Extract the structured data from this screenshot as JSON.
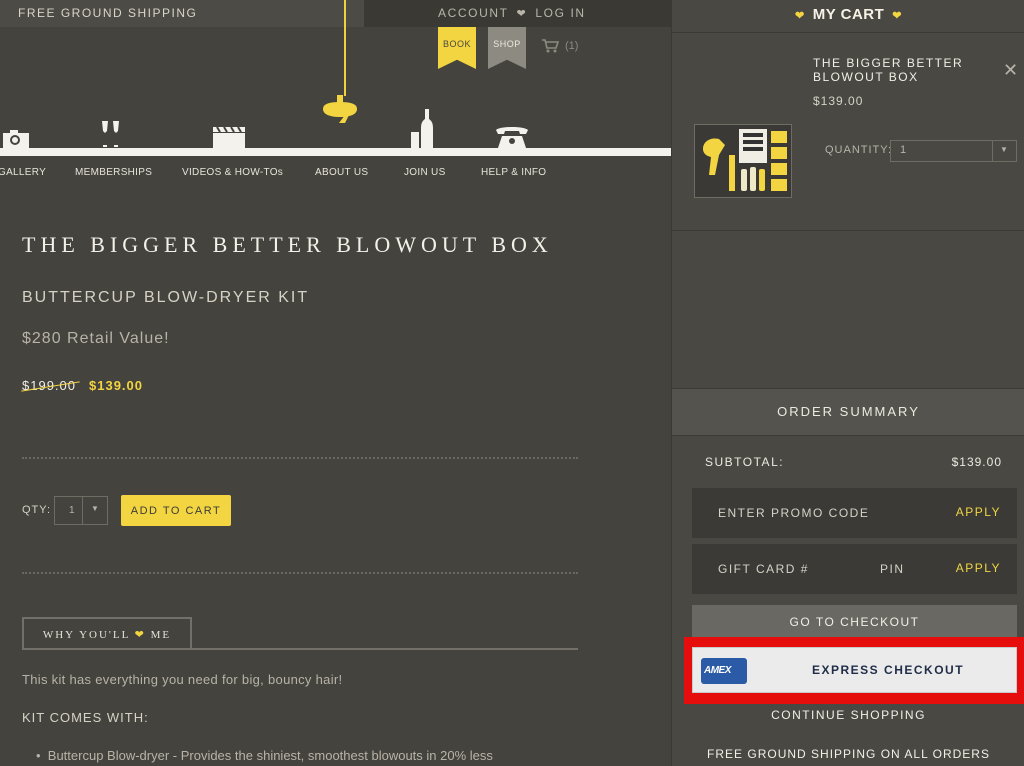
{
  "header": {
    "shipping_text": "FREE GROUND SHIPPING",
    "account_label": "ACCOUNT",
    "login_label": "LOG IN",
    "book_label": "BOOK",
    "shop_label": "SHOP",
    "cart_count": "(1)"
  },
  "nav": {
    "items": [
      "GALLERY",
      "MEMBERSHIPS",
      "VIDEOS & HOW-TOs",
      "ABOUT US",
      "JOIN US",
      "HELP & INFO"
    ]
  },
  "product": {
    "title": "THE BIGGER BETTER BLOWOUT BOX",
    "subtitle": "BUTTERCUP BLOW-DRYER KIT",
    "retail_value": "$280 Retail Value!",
    "old_price": "$199.00",
    "new_price": "$139.00",
    "qty_label": "QTY:",
    "qty_value": "1",
    "add_to_cart": "ADD TO CART",
    "tab_why_before": "WHY YOU'LL",
    "tab_why_after": "ME",
    "description": "This kit has everything you need for big, bouncy hair!",
    "kit_heading": "KIT COMES WITH:",
    "bullet_1": "Buttercup Blow-dryer - Provides the shiniest, smoothest blowouts in 20% less"
  },
  "cart": {
    "heading": "MY CART",
    "item_name": "THE BIGGER BETTER BLOWOUT BOX",
    "item_price": "$139.00",
    "quantity_label": "QUANTITY:",
    "quantity_value": "1",
    "order_summary": "ORDER SUMMARY",
    "subtotal_label": "SUBTOTAL:",
    "subtotal_value": "$139.00",
    "promo_label": "ENTER PROMO CODE",
    "promo_apply": "APPLY",
    "gift_label": "GIFT CARD #",
    "pin_label": "PIN",
    "gift_apply": "APPLY",
    "go_checkout": "GO TO CHECKOUT",
    "amex_label": "AMEX",
    "express_checkout": "EXPRESS CHECKOUT",
    "continue_shopping": "CONTINUE SHOPPING",
    "free_shipping": "FREE GROUND SHIPPING ON ALL ORDERS"
  },
  "colors": {
    "accent_yellow": "#f2d541",
    "page_bg": "#45433d",
    "panel_bg": "#4a4843",
    "highlight_red": "#e60d0d"
  }
}
